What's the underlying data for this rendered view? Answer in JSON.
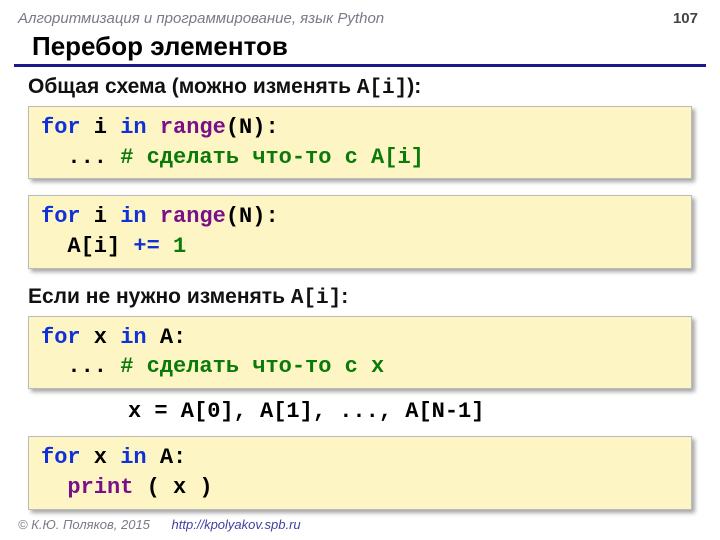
{
  "header": {
    "breadcrumb": "Алгоритмизация и программирование, язык Python",
    "page": "107"
  },
  "title": "Перебор элементов",
  "sub1_prefix": "Общая схема (можно изменять ",
  "sub1_code": "A[i]",
  "sub1_suffix": "):",
  "code1": {
    "l1a": "for",
    "l1b": " i ",
    "l1c": "in",
    "l1d": " ",
    "l1e": "range",
    "l1f": "(N):",
    "l2a": "  ... ",
    "l2b": "# сделать что-то c A[i]"
  },
  "code2": {
    "l1a": "for",
    "l1b": " i ",
    "l1c": "in",
    "l1d": " ",
    "l1e": "range",
    "l1f": "(N):",
    "l2a": "  A[i] ",
    "l2b": "+=",
    "l2c": " ",
    "l2d": "1"
  },
  "sub2_prefix": "Если не нужно изменять ",
  "sub2_code": "A[i]",
  "sub2_suffix": ":",
  "code3": {
    "l1a": "for",
    "l1b": " x ",
    "l1c": "in",
    "l1d": " A:",
    "l2a": "  ... ",
    "l2b": "# сделать что-то c x"
  },
  "note": "x = A[0], A[1], ..., A[N-1]",
  "code4": {
    "l1a": "for",
    "l1b": " x ",
    "l1c": "in",
    "l1d": " A:",
    "l2a": "  ",
    "l2b": "print",
    "l2c": " ( x )"
  },
  "footer": {
    "copyright": "© К.Ю. Поляков, 2015",
    "url": "http://kpolyakov.spb.ru"
  }
}
